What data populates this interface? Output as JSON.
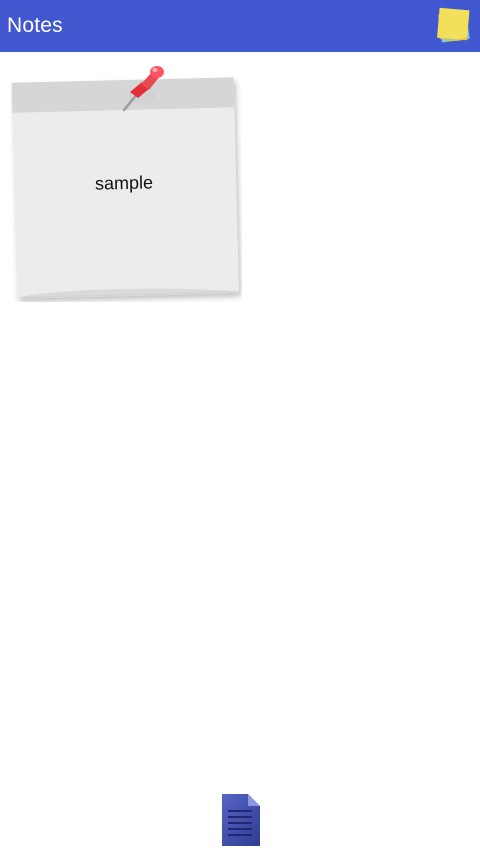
{
  "app": {
    "title": "Notes"
  },
  "notes": [
    {
      "text": "sample"
    }
  ],
  "colors": {
    "appbar": "#4258d0",
    "note_paper": "#ececec",
    "note_band": "#d6d6d6",
    "pin_red": "#e0303a",
    "sticky_yellow": "#f3df5a",
    "doc_blue": "#3e4aa3"
  },
  "icons": {
    "toolbar_action": "sticky-notes-icon",
    "note_pin": "pushpin-icon",
    "add_note": "document-icon"
  }
}
